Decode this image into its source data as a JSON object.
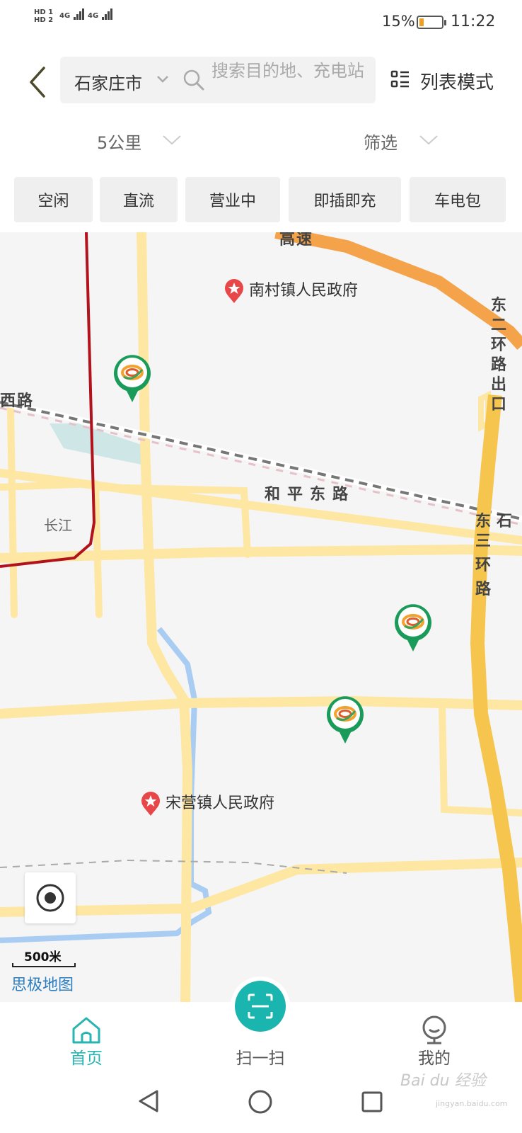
{
  "status_bar": {
    "sim1": "HD 1",
    "sim2": "HD 2",
    "net1": "4G",
    "net2": "4G",
    "battery_percent": "15%",
    "battery_level": 0.15,
    "time": "11:22"
  },
  "header": {
    "back_icon": "chevron-left-icon",
    "city": "石家庄市",
    "search_placeholder": "搜索目的地、充电站",
    "list_mode_icon": "list-icon",
    "list_mode_label": "列表模式"
  },
  "filters": {
    "distance": "5公里",
    "filter": "筛选"
  },
  "chips": [
    "空闲",
    "直流",
    "营业中",
    "即插即充",
    "车电包"
  ],
  "map": {
    "poi_labels": [
      "南村镇人民政府",
      "宋营镇人民政府"
    ],
    "road_labels": [
      "高速",
      "东二环路出口",
      "西路",
      "和平东路",
      "东石",
      "三环路"
    ],
    "area_labels": [
      "长江"
    ],
    "scale": "500米",
    "attribution": "思极地图",
    "colors": {
      "road": "#fde7a2",
      "expressway": "#f4a34a",
      "ring_road": "#f5c54e",
      "metro": "#b2121b",
      "water": "#a9cdf2",
      "station_green": "#1a9b5a"
    }
  },
  "tabbar": {
    "home": "首页",
    "scan": "扫一扫",
    "mine": "我的",
    "accent": "#28b4b0"
  },
  "watermark": {
    "brand": "Bai du 经验",
    "site": "jingyan.baidu.com"
  }
}
